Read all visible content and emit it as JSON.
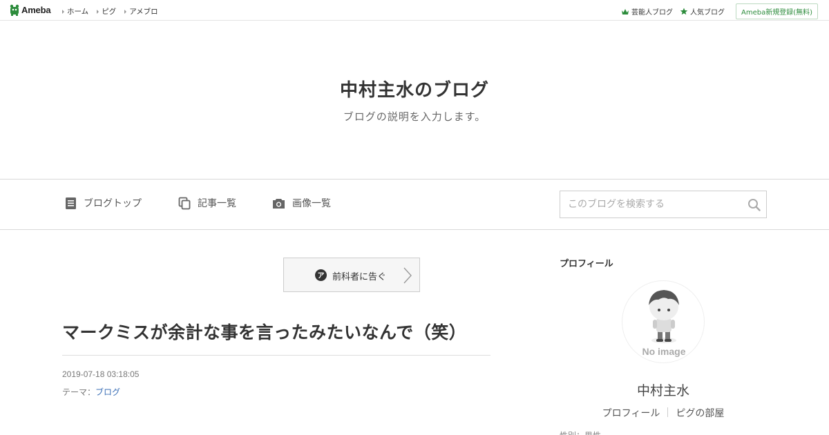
{
  "topbar": {
    "logo_text": "Ameba",
    "nav": [
      "ホーム",
      "ピグ",
      "アメブロ"
    ],
    "celebrity_blog": "芸能人ブログ",
    "popular_blog": "人気ブログ",
    "signup": "Ameba新規登録(無料)",
    "accent_color": "#2d8c3c"
  },
  "header": {
    "title": "中村主水のブログ",
    "description": "ブログの説明を入力します。"
  },
  "blog_nav": {
    "top": "ブログトップ",
    "articles": "記事一覧",
    "images": "画像一覧",
    "search_placeholder": "このブログを検索する"
  },
  "theme_nav": {
    "label": "前科者に告ぐ",
    "badge": "ア"
  },
  "entry": {
    "title": "マークミスが余計な事を言ったみたいなんで（笑）",
    "date": "2019-07-18 03:18:05",
    "theme_prefix": "テーマ：",
    "theme_link": "ブログ"
  },
  "sidebar": {
    "heading": "プロフィール",
    "avatar_caption": "No image",
    "name": "中村主水",
    "links": [
      "プロフィール",
      "ピグの部屋"
    ],
    "cut_text": "性別：男性"
  }
}
